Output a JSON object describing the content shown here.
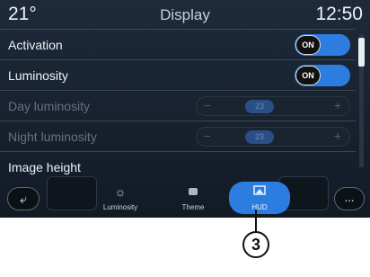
{
  "status": {
    "temperature": "21°",
    "title": "Display",
    "time": "12:50"
  },
  "settings": [
    {
      "label": "Activation",
      "toggle": "ON"
    },
    {
      "label": "Luminosity",
      "toggle": "ON"
    },
    {
      "label": "Day luminosity",
      "value": "23",
      "minus": "−",
      "plus": "+"
    },
    {
      "label": "Night luminosity",
      "value": "23",
      "minus": "−",
      "plus": "+"
    },
    {
      "label": "Image height"
    }
  ],
  "tabs": [
    {
      "label": "Luminosity",
      "icon": "sun-icon"
    },
    {
      "label": "Theme",
      "icon": "theme-icon"
    },
    {
      "label": "HUD",
      "icon": "hud-icon",
      "active": true
    }
  ],
  "back_icon": "back-arrow-icon",
  "more_label": "...",
  "callout": "3",
  "colors": {
    "accent": "#2d7de0",
    "background": "#17212e",
    "text": "#eef2f7"
  }
}
